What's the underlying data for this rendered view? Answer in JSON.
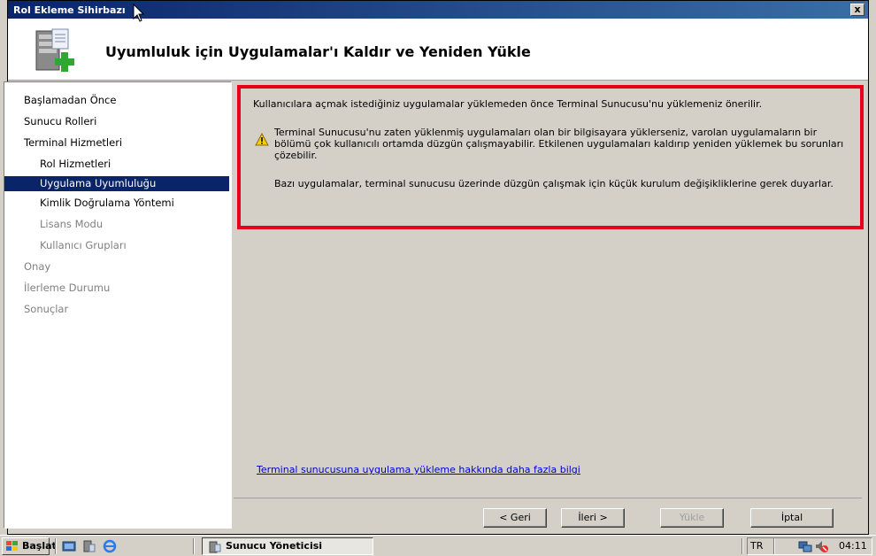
{
  "window": {
    "title": "Rol Ekleme Sihirbazı",
    "close_label": "x",
    "header_title": "Uyumluluk için Uygulamalar'ı Kaldır ve Yeniden Yükle"
  },
  "nav": {
    "items": [
      {
        "label": "Başlamadan Önce"
      },
      {
        "label": "Sunucu Rolleri"
      },
      {
        "label": "Terminal Hizmetleri"
      },
      {
        "label": "Rol Hizmetleri"
      },
      {
        "label": "Uygulama Uyumluluğu"
      },
      {
        "label": "Kimlik Doğrulama Yöntemi"
      },
      {
        "label": "Lisans Modu"
      },
      {
        "label": "Kullanıcı Grupları"
      },
      {
        "label": "Onay"
      },
      {
        "label": "İlerleme Durumu"
      },
      {
        "label": "Sonuçlar"
      }
    ],
    "active_index": 4
  },
  "content": {
    "intro": "Kullanıcılara açmak istediğiniz uygulamalar yüklemeden önce Terminal Sunucusu'nu yüklemeniz önerilir.",
    "warning": "Terminal Sunucusu'nu zaten yüklenmiş uygulamaları olan bir bilgisayara yüklerseniz, varolan uygulamaların bir bölümü çok kullanıcılı ortamda düzgün çalışmayabilir. Etkilenen uygulamaları kaldırıp yeniden yüklemek bu sorunları çözebilir.",
    "note": "Bazı uygulamalar, terminal sunucusu üzerinde düzgün çalışmak için küçük kurulum değişikliklerine gerek duyarlar.",
    "help_link": "Terminal sunucusuna uygulama yükleme hakkında daha fazla bilgi",
    "highlight_color": "#e8001a"
  },
  "buttons": {
    "back": "< Geri",
    "next": "İleri >",
    "install": "Yükle",
    "cancel": "İptal"
  },
  "taskbar": {
    "start_label": "Başlat",
    "task_label": "Sunucu Yöneticisi",
    "language": "TR",
    "clock": "04:11"
  }
}
